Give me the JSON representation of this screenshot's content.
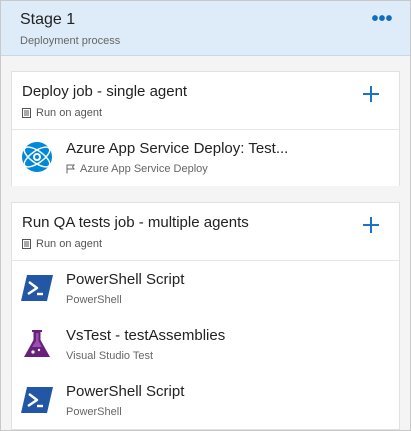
{
  "stage": {
    "title": "Stage 1",
    "subtitle": "Deployment process",
    "more_label": "•••"
  },
  "jobs": [
    {
      "title": "Deploy job - single agent",
      "subtitle": "Run on agent",
      "tasks": [
        {
          "title": "Azure App Service Deploy: Test...",
          "subtitle": "Azure App Service Deploy",
          "icon": "azure-app-service-icon"
        }
      ]
    },
    {
      "title": "Run QA tests job - multiple agents",
      "subtitle": "Run on agent",
      "tasks": [
        {
          "title": "PowerShell Script",
          "subtitle": "PowerShell",
          "icon": "powershell-icon"
        },
        {
          "title": "VsTest - testAssemblies",
          "subtitle": "Visual Studio Test",
          "icon": "vstest-flask-icon"
        },
        {
          "title": "PowerShell Script",
          "subtitle": "PowerShell",
          "icon": "powershell-icon"
        }
      ]
    }
  ],
  "colors": {
    "accent": "#1a73c7",
    "header_bg": "#deecf9",
    "powershell": "#2456a6",
    "vstest": "#68217a",
    "azure": "#0089d6"
  }
}
